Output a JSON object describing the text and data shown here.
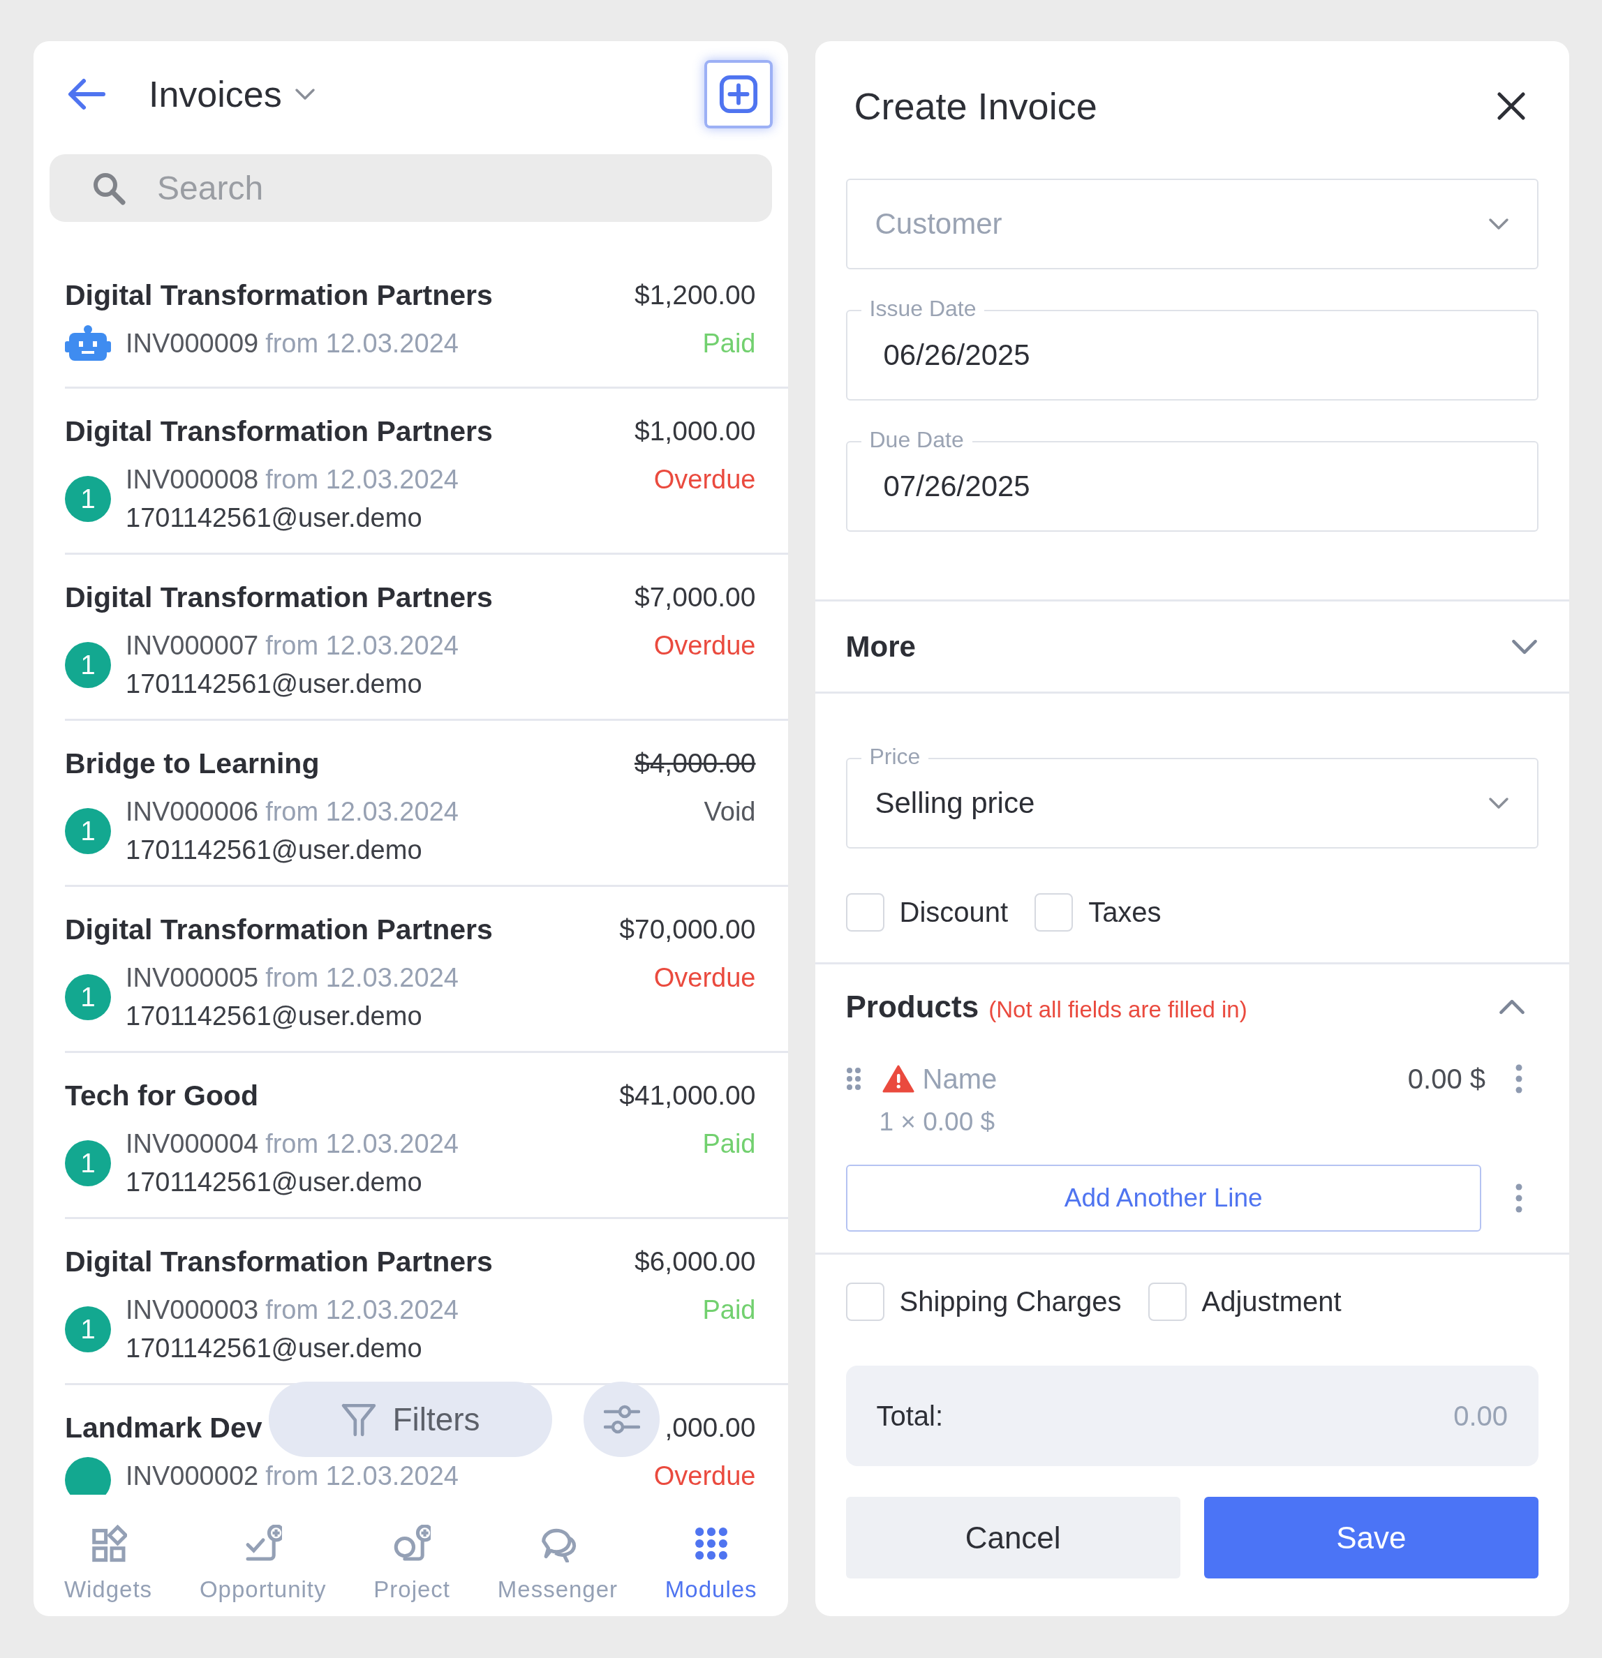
{
  "list_header": {
    "title": "Invoices"
  },
  "search": {
    "placeholder": "Search"
  },
  "invoices": [
    {
      "customer": "Digital Transformation Partners",
      "amount": "$1,200.00",
      "struck": false,
      "number": "INV000009",
      "date": "from 12.03.2024",
      "status": "Paid",
      "color": "#72d06f",
      "avatar": {
        "kind": "bot"
      }
    },
    {
      "customer": "Digital Transformation Partners",
      "amount": "$1,000.00",
      "struck": false,
      "number": "INV000008",
      "date": "from 12.03.2024",
      "status": "Overdue",
      "color": "#ea4a3e",
      "email": "1701142561@user.demo",
      "avatar": {
        "kind": "user",
        "label": "1"
      }
    },
    {
      "customer": "Digital Transformation Partners",
      "amount": "$7,000.00",
      "struck": false,
      "number": "INV000007",
      "date": "from 12.03.2024",
      "status": "Overdue",
      "color": "#ea4a3e",
      "email": "1701142561@user.demo",
      "avatar": {
        "kind": "user",
        "label": "1"
      }
    },
    {
      "customer": "Bridge to Learning",
      "amount": "$4,000.00",
      "struck": true,
      "number": "INV000006",
      "date": "from 12.03.2024",
      "status": "Void",
      "color": "#55585f",
      "email": "1701142561@user.demo",
      "avatar": {
        "kind": "user",
        "label": "1"
      }
    },
    {
      "customer": "Digital Transformation Partners",
      "amount": "$70,000.00",
      "struck": false,
      "number": "INV000005",
      "date": "from 12.03.2024",
      "status": "Overdue",
      "color": "#ea4a3e",
      "email": "1701142561@user.demo",
      "avatar": {
        "kind": "user",
        "label": "1"
      }
    },
    {
      "customer": "Tech for Good",
      "amount": "$41,000.00",
      "struck": false,
      "number": "INV000004",
      "date": "from 12.03.2024",
      "status": "Paid",
      "color": "#72d06f",
      "email": "1701142561@user.demo",
      "avatar": {
        "kind": "user",
        "label": "1"
      }
    },
    {
      "customer": "Digital Transformation Partners",
      "amount": "$6,000.00",
      "struck": false,
      "number": "INV000003",
      "date": "from 12.03.2024",
      "status": "Paid",
      "color": "#72d06f",
      "email": "1701142561@user.demo",
      "avatar": {
        "kind": "user",
        "label": "1"
      }
    },
    {
      "customer": "Landmark Dev",
      "amount": ",000.00",
      "struck": false,
      "number": "INV000002",
      "date": "from 12.03.2024",
      "status": "Overdue",
      "color": "#ea4a3e",
      "avatar": {
        "kind": "user"
      }
    }
  ],
  "filters": {
    "label": "Filters"
  },
  "nav": [
    {
      "label": "Widgets",
      "selected": false
    },
    {
      "label": "Opportunity",
      "selected": false
    },
    {
      "label": "Project",
      "selected": false
    },
    {
      "label": "Messenger",
      "selected": false
    },
    {
      "label": "Modules",
      "selected": true
    }
  ],
  "form": {
    "title": "Create Invoice",
    "customer": {
      "placeholder": "Customer"
    },
    "issue_date": {
      "label": "Issue Date",
      "value": "06/26/2025"
    },
    "due_date": {
      "label": "Due Date",
      "value": "07/26/2025"
    },
    "more": {
      "label": "More",
      "expanded": false
    },
    "price": {
      "label": "Price",
      "value": "Selling price"
    },
    "options": [
      {
        "label": "Discount",
        "checked": false
      },
      {
        "label": "Taxes",
        "checked": false
      }
    ],
    "products": {
      "title": "Products",
      "warning": "(Not all fields are filled in)",
      "expanded": true,
      "lines": [
        {
          "name_placeholder": "Name",
          "invalid": true,
          "total": "0.00 $",
          "quantity": "1 × 0.00 $"
        }
      ],
      "add_label": "Add Another Line"
    },
    "extras": [
      {
        "label": "Shipping Charges",
        "checked": false
      },
      {
        "label": "Adjustment",
        "checked": false
      }
    ],
    "total": {
      "label": "Total:",
      "value": "0.00"
    },
    "buttons": [
      {
        "label": "Cancel",
        "kind": "secondary"
      },
      {
        "label": "Save",
        "kind": "primary"
      }
    ]
  }
}
